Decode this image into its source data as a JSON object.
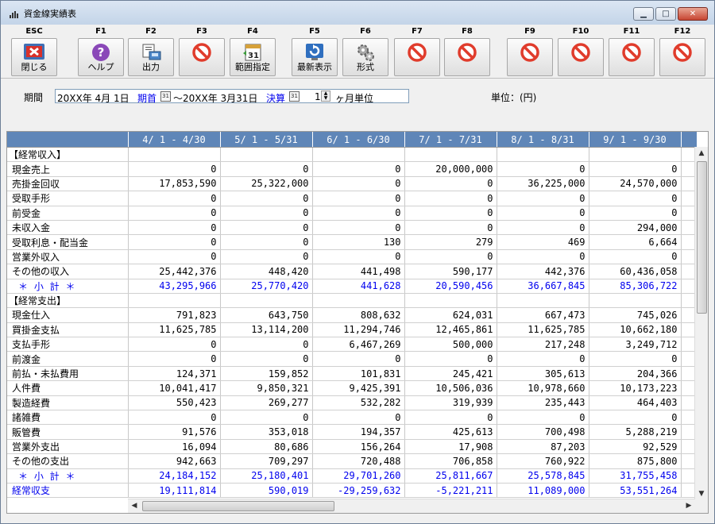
{
  "window": {
    "title": "資金線実績表"
  },
  "toolbar": {
    "buttons": [
      {
        "key": "ESC",
        "label": "閉じる",
        "icon": "close-x-icon"
      },
      {
        "key": "F1",
        "label": "ヘルプ",
        "icon": "help-question-icon"
      },
      {
        "key": "F2",
        "label": "出力",
        "icon": "output-printer-icon"
      },
      {
        "key": "F3",
        "label": "",
        "icon": "disabled-prohibit-icon"
      },
      {
        "key": "F4",
        "label": "範囲指定",
        "icon": "calendar-range-icon"
      },
      {
        "key": "F5",
        "label": "最新表示",
        "icon": "refresh-icon"
      },
      {
        "key": "F6",
        "label": "形式",
        "icon": "format-gear-icon"
      },
      {
        "key": "F7",
        "label": "",
        "icon": "disabled-prohibit-icon"
      },
      {
        "key": "F8",
        "label": "",
        "icon": "disabled-prohibit-icon"
      },
      {
        "key": "F9",
        "label": "",
        "icon": "disabled-prohibit-icon"
      },
      {
        "key": "F10",
        "label": "",
        "icon": "disabled-prohibit-icon"
      },
      {
        "key": "F11",
        "label": "",
        "icon": "disabled-prohibit-icon"
      },
      {
        "key": "F12",
        "label": "",
        "icon": "disabled-prohibit-icon"
      }
    ]
  },
  "period": {
    "label": "期間",
    "start": "20XX年 4月 1日",
    "start_kind": "期首",
    "tilde": "～",
    "end": "20XX年 3月31日",
    "end_kind": "決算",
    "months": "1",
    "months_unit": "ヶ月単位",
    "unit_label": "単位：(円)",
    "calendar_glyph": "31"
  },
  "grid": {
    "columns": [
      "4/ 1 -  4/30",
      "5/ 1 -  5/31",
      "6/ 1 -  6/30",
      "7/ 1 -  7/31",
      "8/ 1 -  8/31",
      "9/ 1 -  9/30"
    ],
    "rows": [
      {
        "label": "【経常収入】",
        "kind": "section",
        "values": [
          "",
          "",
          "",
          "",
          "",
          ""
        ]
      },
      {
        "label": "現金売上",
        "kind": "item",
        "values": [
          "0",
          "0",
          "0",
          "20,000,000",
          "0",
          "0"
        ]
      },
      {
        "label": "売掛金回収",
        "kind": "item",
        "values": [
          "17,853,590",
          "25,322,000",
          "0",
          "0",
          "36,225,000",
          "24,570,000"
        ]
      },
      {
        "label": "受取手形",
        "kind": "item",
        "values": [
          "0",
          "0",
          "0",
          "0",
          "0",
          "0"
        ]
      },
      {
        "label": "前受金",
        "kind": "item",
        "values": [
          "0",
          "0",
          "0",
          "0",
          "0",
          "0"
        ]
      },
      {
        "label": "未収入金",
        "kind": "item",
        "values": [
          "0",
          "0",
          "0",
          "0",
          "0",
          "294,000"
        ]
      },
      {
        "label": "受取利息・配当金",
        "kind": "item",
        "values": [
          "0",
          "0",
          "130",
          "279",
          "469",
          "6,664"
        ]
      },
      {
        "label": "営業外収入",
        "kind": "item",
        "values": [
          "0",
          "0",
          "0",
          "0",
          "0",
          "0"
        ]
      },
      {
        "label": "その他の収入",
        "kind": "item",
        "values": [
          "25,442,376",
          "448,420",
          "441,498",
          "590,177",
          "442,376",
          "60,436,058"
        ]
      },
      {
        "label": "＊ 小 計 ＊",
        "kind": "subtotal",
        "values": [
          "43,295,966",
          "25,770,420",
          "441,628",
          "20,590,456",
          "36,667,845",
          "85,306,722"
        ]
      },
      {
        "label": "【経常支出】",
        "kind": "section",
        "values": [
          "",
          "",
          "",
          "",
          "",
          ""
        ]
      },
      {
        "label": "現金仕入",
        "kind": "item",
        "values": [
          "791,823",
          "643,750",
          "808,632",
          "624,031",
          "667,473",
          "745,026"
        ]
      },
      {
        "label": "買掛金支払",
        "kind": "item",
        "values": [
          "11,625,785",
          "13,114,200",
          "11,294,746",
          "12,465,861",
          "11,625,785",
          "10,662,180"
        ]
      },
      {
        "label": "支払手形",
        "kind": "item",
        "values": [
          "0",
          "0",
          "6,467,269",
          "500,000",
          "217,248",
          "3,249,712"
        ]
      },
      {
        "label": "前渡金",
        "kind": "item",
        "values": [
          "0",
          "0",
          "0",
          "0",
          "0",
          "0"
        ]
      },
      {
        "label": "前払・未払費用",
        "kind": "item",
        "values": [
          "124,371",
          "159,852",
          "101,831",
          "245,421",
          "305,613",
          "204,366"
        ]
      },
      {
        "label": "人件費",
        "kind": "item",
        "values": [
          "10,041,417",
          "9,850,321",
          "9,425,391",
          "10,506,036",
          "10,978,660",
          "10,173,223"
        ]
      },
      {
        "label": "製造経費",
        "kind": "item",
        "values": [
          "550,423",
          "269,277",
          "532,282",
          "319,939",
          "235,443",
          "464,403"
        ]
      },
      {
        "label": "諸雑費",
        "kind": "item",
        "values": [
          "0",
          "0",
          "0",
          "0",
          "0",
          "0"
        ]
      },
      {
        "label": "販管費",
        "kind": "item",
        "values": [
          "91,576",
          "353,018",
          "194,357",
          "425,613",
          "700,498",
          "5,288,219"
        ]
      },
      {
        "label": "営業外支出",
        "kind": "item",
        "values": [
          "16,094",
          "80,686",
          "156,264",
          "17,908",
          "87,203",
          "92,529"
        ]
      },
      {
        "label": "その他の支出",
        "kind": "item",
        "values": [
          "942,663",
          "709,297",
          "720,488",
          "706,858",
          "760,922",
          "875,800"
        ]
      },
      {
        "label": "＊ 小 計 ＊",
        "kind": "subtotal",
        "values": [
          "24,184,152",
          "25,180,401",
          "29,701,260",
          "25,811,667",
          "25,578,845",
          "31,755,458"
        ]
      },
      {
        "label": "経常収支",
        "kind": "net",
        "values": [
          "19,111,814",
          "590,019",
          "-29,259,632",
          "-5,221,211",
          "11,089,000",
          "53,551,264"
        ]
      }
    ]
  },
  "colors": {
    "header_bg": "#5f86b8",
    "subtotal_text": "#0000ee",
    "close_red": "#d9302a",
    "prohibit_red": "#e03c2c"
  }
}
